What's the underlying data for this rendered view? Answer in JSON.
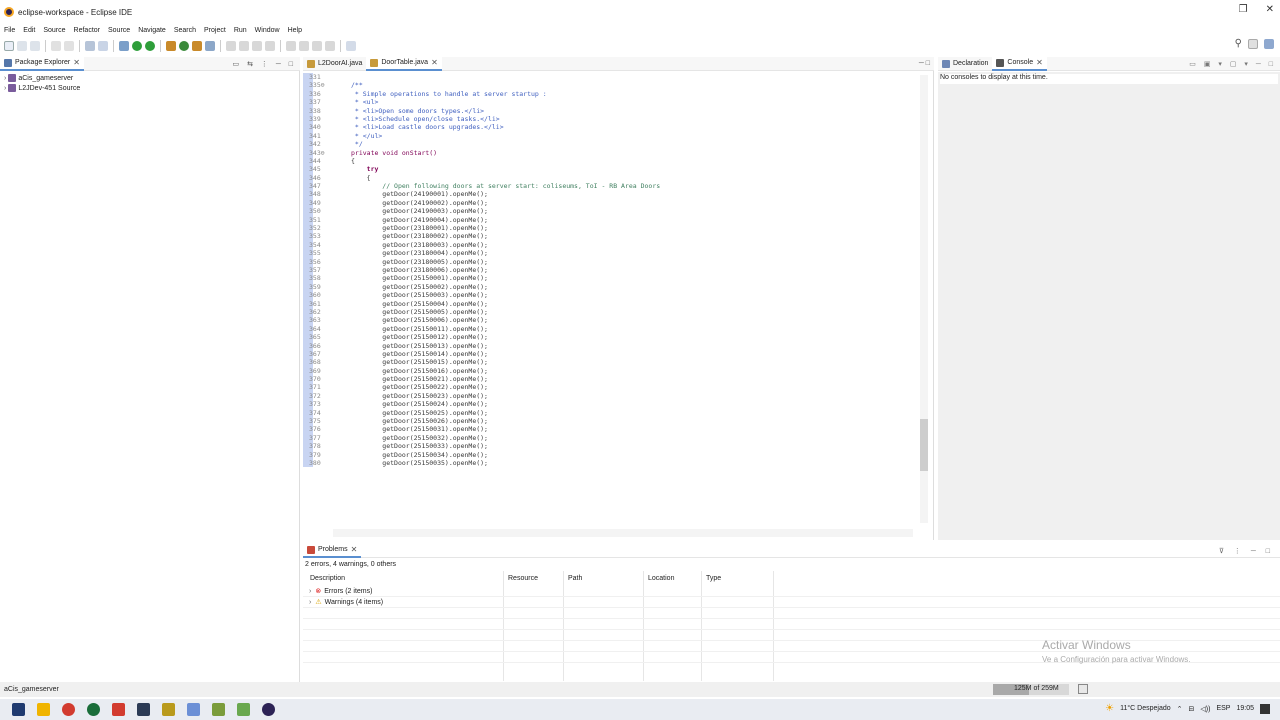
{
  "window": {
    "title": "eclipse-workspace - Eclipse IDE"
  },
  "menu": [
    "File",
    "Edit",
    "Source",
    "Refactor",
    "Source",
    "Navigate",
    "Search",
    "Project",
    "Run",
    "Window",
    "Help"
  ],
  "package_explorer": {
    "tab_label": "Package Explorer",
    "items": [
      "aCis_gameserver",
      "L2JDev-451 Source"
    ]
  },
  "editor": {
    "tabs": [
      {
        "label": "L2DoorAI.java",
        "active": false
      },
      {
        "label": "DoorTable.java",
        "active": true
      }
    ],
    "lines": [
      {
        "n": "331",
        "t": "",
        "k": "code"
      },
      {
        "n": "335⊖",
        "t": "/**",
        "k": "jd"
      },
      {
        "n": "336",
        "t": " * Simple operations to handle at server startup :",
        "k": "jd"
      },
      {
        "n": "337",
        "t": " * <ul>",
        "k": "jd"
      },
      {
        "n": "338",
        "t": " * <li>Open some doors types.</li>",
        "k": "jd"
      },
      {
        "n": "339",
        "t": " * <li>Schedule open/close tasks.</li>",
        "k": "jd"
      },
      {
        "n": "340",
        "t": " * <li>Load castle doors upgrades.</li>",
        "k": "jd"
      },
      {
        "n": "341",
        "t": " * </ul>",
        "k": "jd"
      },
      {
        "n": "342",
        "t": " */",
        "k": "jd"
      },
      {
        "n": "343⊖",
        "t": "private void onStart()",
        "k": "kwline"
      },
      {
        "n": "344",
        "t": "{",
        "k": "code"
      },
      {
        "n": "345",
        "t": "    try",
        "k": "try"
      },
      {
        "n": "346",
        "t": "    {",
        "k": "code"
      },
      {
        "n": "347",
        "t": "        // Open following doors at server start: coliseums, ToI - RB Area Doors",
        "k": "cm"
      },
      {
        "n": "348",
        "t": "        getDoor(24190001).openMe();",
        "k": "code"
      },
      {
        "n": "349",
        "t": "        getDoor(24190002).openMe();",
        "k": "code"
      },
      {
        "n": "350",
        "t": "        getDoor(24190003).openMe();",
        "k": "code"
      },
      {
        "n": "351",
        "t": "        getDoor(24190004).openMe();",
        "k": "code"
      },
      {
        "n": "352",
        "t": "        getDoor(23180001).openMe();",
        "k": "code"
      },
      {
        "n": "353",
        "t": "        getDoor(23180002).openMe();",
        "k": "code"
      },
      {
        "n": "354",
        "t": "        getDoor(23180003).openMe();",
        "k": "code"
      },
      {
        "n": "355",
        "t": "        getDoor(23180004).openMe();",
        "k": "code"
      },
      {
        "n": "356",
        "t": "        getDoor(23180005).openMe();",
        "k": "code"
      },
      {
        "n": "357",
        "t": "        getDoor(23180006).openMe();",
        "k": "code"
      },
      {
        "n": "358",
        "t": "        getDoor(25150001).openMe();",
        "k": "code"
      },
      {
        "n": "359",
        "t": "        getDoor(25150002).openMe();",
        "k": "code"
      },
      {
        "n": "360",
        "t": "        getDoor(25150003).openMe();",
        "k": "code"
      },
      {
        "n": "361",
        "t": "        getDoor(25150004).openMe();",
        "k": "code"
      },
      {
        "n": "362",
        "t": "        getDoor(25150005).openMe();",
        "k": "code"
      },
      {
        "n": "363",
        "t": "        getDoor(25150006).openMe();",
        "k": "code"
      },
      {
        "n": "364",
        "t": "        getDoor(25150011).openMe();",
        "k": "code"
      },
      {
        "n": "365",
        "t": "        getDoor(25150012).openMe();",
        "k": "code"
      },
      {
        "n": "366",
        "t": "        getDoor(25150013).openMe();",
        "k": "code"
      },
      {
        "n": "367",
        "t": "        getDoor(25150014).openMe();",
        "k": "code"
      },
      {
        "n": "368",
        "t": "        getDoor(25150015).openMe();",
        "k": "code"
      },
      {
        "n": "369",
        "t": "        getDoor(25150016).openMe();",
        "k": "code"
      },
      {
        "n": "370",
        "t": "        getDoor(25150021).openMe();",
        "k": "code"
      },
      {
        "n": "371",
        "t": "        getDoor(25150022).openMe();",
        "k": "code"
      },
      {
        "n": "372",
        "t": "        getDoor(25150023).openMe();",
        "k": "code"
      },
      {
        "n": "373",
        "t": "        getDoor(25150024).openMe();",
        "k": "code"
      },
      {
        "n": "374",
        "t": "        getDoor(25150025).openMe();",
        "k": "code"
      },
      {
        "n": "375",
        "t": "        getDoor(25150026).openMe();",
        "k": "code"
      },
      {
        "n": "376",
        "t": "        getDoor(25150031).openMe();",
        "k": "code"
      },
      {
        "n": "377",
        "t": "        getDoor(25150032).openMe();",
        "k": "code"
      },
      {
        "n": "378",
        "t": "        getDoor(25150033).openMe();",
        "k": "code"
      },
      {
        "n": "379",
        "t": "        getDoor(25150034).openMe();",
        "k": "code"
      },
      {
        "n": "380",
        "t": "        getDoor(25150035).openMe();",
        "k": "code"
      }
    ]
  },
  "right_pane": {
    "tabs": [
      {
        "label": "Declaration",
        "active": false
      },
      {
        "label": "Console",
        "active": true
      }
    ],
    "message": "No consoles to display at this time."
  },
  "problems": {
    "tab_label": "Problems",
    "summary": "2 errors, 4 warnings, 0 others",
    "columns": [
      "Description",
      "Resource",
      "Path",
      "Location",
      "Type"
    ],
    "rows": [
      {
        "label": "Errors (2 items)"
      },
      {
        "label": "Warnings (4 items)"
      }
    ]
  },
  "watermark": {
    "line1": "Activar Windows",
    "line2": "Ve a Configuración para activar Windows."
  },
  "status": {
    "selection": "aCis_gameserver",
    "heap": "125M of 259M",
    "heap_fraction": 0.48
  },
  "tray": {
    "weather": "11°C Despejado",
    "lang": "ESP",
    "time": "19:05"
  },
  "colors": {
    "selection_bar": "#5a8fd0",
    "keyword": "#7f0055",
    "comment": "#3f7f5f",
    "javadoc": "#3f5fbf"
  }
}
